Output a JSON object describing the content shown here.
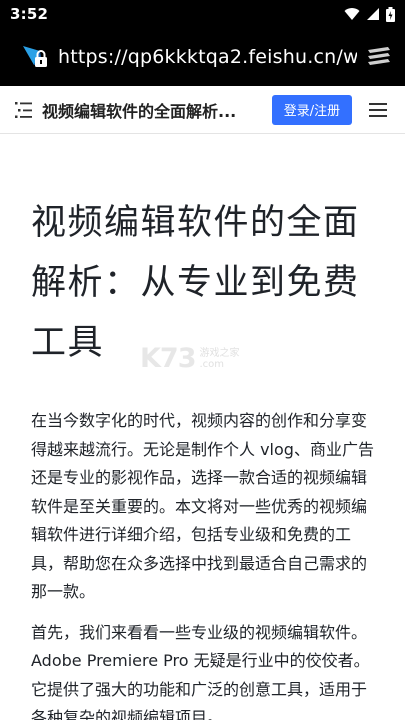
{
  "status_bar": {
    "time": "3:52",
    "icons": [
      "wifi-icon",
      "signal-icon",
      "battery-icon"
    ]
  },
  "browser": {
    "url": "https://qp6kkktqa2.feishu.cn/w",
    "icons": [
      "site-lock-icon",
      "tabs-icon"
    ]
  },
  "site_header": {
    "title": "视频编辑软件的全面解析...",
    "login_label": "登录/注册",
    "login_color": "#3370ff",
    "icons": [
      "toc-icon",
      "menu-icon"
    ]
  },
  "article": {
    "title": "视频编辑软件的全面解析：从专业到免费工具",
    "paragraphs": [
      "在当今数字化的时代，视频内容的创作和分享变得越来越流行。无论是制作个人 vlog、商业广告还是专业的影视作品，选择一款合适的视频编辑软件是至关重要的。本文将对一些优秀的视频编辑软件进行详细介绍，包括专业级和免费的工具，帮助您在众多选择中找到最适合自己需求的那一款。",
      "首先，我们来看看一些专业级的视频编辑软件。Adobe Premiere Pro 无疑是行业中的佼佼者。它提供了强大的功能和广泛的创意工具，适用于各种复杂的视频编辑项目。"
    ]
  },
  "watermark": {
    "logo": "K73",
    "line1": "游戏之家",
    "line2": ".com"
  }
}
